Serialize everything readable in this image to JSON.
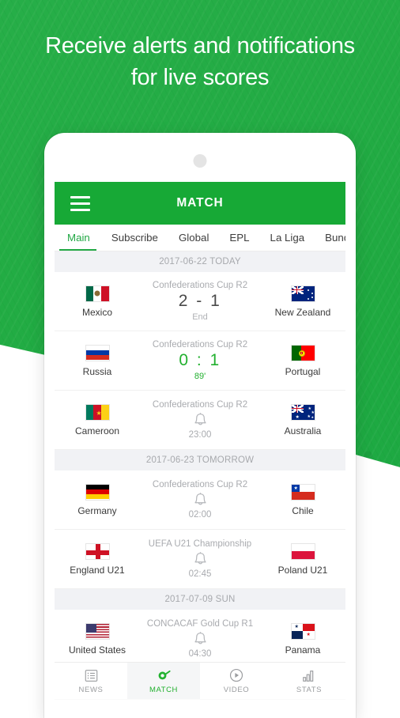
{
  "headline": {
    "line1": "Receive alerts and notifications",
    "line2": "for live scores"
  },
  "colors": {
    "brand_green": "#17a936",
    "live_green": "#22b02f",
    "tab_active": "#22a845",
    "muted_text": "#a9abaf",
    "date_header_bg": "#f1f2f5"
  },
  "appbar": {
    "menu_icon": "hamburger-icon",
    "title": "MATCH"
  },
  "tabs": [
    {
      "label": "Main",
      "active": true
    },
    {
      "label": "Subscribe",
      "active": false
    },
    {
      "label": "Global",
      "active": false
    },
    {
      "label": "EPL",
      "active": false
    },
    {
      "label": "La Liga",
      "active": false
    },
    {
      "label": "Bundes",
      "active": false
    }
  ],
  "sections": [
    {
      "date": "2017-06-22 TODAY",
      "matches": [
        {
          "competition": "Confederations Cup R2",
          "home": "Mexico",
          "away": "New Zealand",
          "score": "2 - 1",
          "status": "End",
          "state": "finished"
        },
        {
          "competition": "Confederations Cup R2",
          "home": "Russia",
          "away": "Portugal",
          "score": "0 : 1",
          "status": "89'",
          "state": "live"
        },
        {
          "competition": "Confederations Cup R2",
          "home": "Cameroon",
          "away": "Australia",
          "time": "23:00",
          "alert_icon": "bell-icon",
          "state": "scheduled"
        }
      ]
    },
    {
      "date": "2017-06-23 TOMORROW",
      "matches": [
        {
          "competition": "Confederations Cup R2",
          "home": "Germany",
          "away": "Chile",
          "time": "02:00",
          "alert_icon": "bell-icon",
          "state": "scheduled"
        },
        {
          "competition": "UEFA U21 Championship",
          "home": "England U21",
          "away": "Poland U21",
          "time": "02:45",
          "alert_icon": "bell-icon",
          "state": "scheduled"
        }
      ]
    },
    {
      "date": "2017-07-09 SUN",
      "matches": [
        {
          "competition": "CONCACAF Gold Cup R1",
          "home": "United States",
          "away": "Panama",
          "time": "04:30",
          "alert_icon": "bell-icon",
          "state": "scheduled"
        }
      ]
    }
  ],
  "bottom_nav": [
    {
      "label": "NEWS",
      "icon": "list-icon",
      "active": false
    },
    {
      "label": "MATCH",
      "icon": "whistle-icon",
      "active": true
    },
    {
      "label": "VIDEO",
      "icon": "play-circle-icon",
      "active": false
    },
    {
      "label": "STATS",
      "icon": "bar-chart-icon",
      "active": false
    }
  ]
}
